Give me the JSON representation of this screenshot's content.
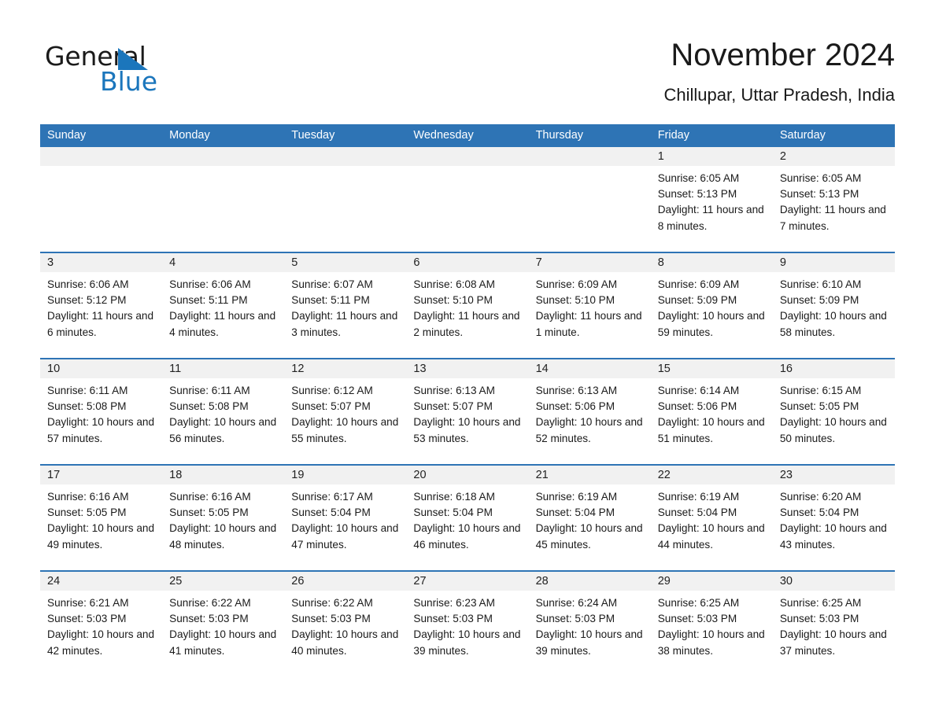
{
  "brand": {
    "name_part1": "General",
    "name_part2": "Blue",
    "accent_color": "#1b76bc"
  },
  "header": {
    "title": "November 2024",
    "subtitle": "Chillupar, Uttar Pradesh, India"
  },
  "theme": {
    "header_blue": "#2e74b5",
    "band_gray": "#f1f1f1",
    "text": "#1a1a1a"
  },
  "weekdays": [
    "Sunday",
    "Monday",
    "Tuesday",
    "Wednesday",
    "Thursday",
    "Friday",
    "Saturday"
  ],
  "weeks": [
    [
      {
        "day": "",
        "sunrise": "",
        "sunset": "",
        "daylight": ""
      },
      {
        "day": "",
        "sunrise": "",
        "sunset": "",
        "daylight": ""
      },
      {
        "day": "",
        "sunrise": "",
        "sunset": "",
        "daylight": ""
      },
      {
        "day": "",
        "sunrise": "",
        "sunset": "",
        "daylight": ""
      },
      {
        "day": "",
        "sunrise": "",
        "sunset": "",
        "daylight": ""
      },
      {
        "day": "1",
        "sunrise": "Sunrise: 6:05 AM",
        "sunset": "Sunset: 5:13 PM",
        "daylight": "Daylight: 11 hours and 8 minutes."
      },
      {
        "day": "2",
        "sunrise": "Sunrise: 6:05 AM",
        "sunset": "Sunset: 5:13 PM",
        "daylight": "Daylight: 11 hours and 7 minutes."
      }
    ],
    [
      {
        "day": "3",
        "sunrise": "Sunrise: 6:06 AM",
        "sunset": "Sunset: 5:12 PM",
        "daylight": "Daylight: 11 hours and 6 minutes."
      },
      {
        "day": "4",
        "sunrise": "Sunrise: 6:06 AM",
        "sunset": "Sunset: 5:11 PM",
        "daylight": "Daylight: 11 hours and 4 minutes."
      },
      {
        "day": "5",
        "sunrise": "Sunrise: 6:07 AM",
        "sunset": "Sunset: 5:11 PM",
        "daylight": "Daylight: 11 hours and 3 minutes."
      },
      {
        "day": "6",
        "sunrise": "Sunrise: 6:08 AM",
        "sunset": "Sunset: 5:10 PM",
        "daylight": "Daylight: 11 hours and 2 minutes."
      },
      {
        "day": "7",
        "sunrise": "Sunrise: 6:09 AM",
        "sunset": "Sunset: 5:10 PM",
        "daylight": "Daylight: 11 hours and 1 minute."
      },
      {
        "day": "8",
        "sunrise": "Sunrise: 6:09 AM",
        "sunset": "Sunset: 5:09 PM",
        "daylight": "Daylight: 10 hours and 59 minutes."
      },
      {
        "day": "9",
        "sunrise": "Sunrise: 6:10 AM",
        "sunset": "Sunset: 5:09 PM",
        "daylight": "Daylight: 10 hours and 58 minutes."
      }
    ],
    [
      {
        "day": "10",
        "sunrise": "Sunrise: 6:11 AM",
        "sunset": "Sunset: 5:08 PM",
        "daylight": "Daylight: 10 hours and 57 minutes."
      },
      {
        "day": "11",
        "sunrise": "Sunrise: 6:11 AM",
        "sunset": "Sunset: 5:08 PM",
        "daylight": "Daylight: 10 hours and 56 minutes."
      },
      {
        "day": "12",
        "sunrise": "Sunrise: 6:12 AM",
        "sunset": "Sunset: 5:07 PM",
        "daylight": "Daylight: 10 hours and 55 minutes."
      },
      {
        "day": "13",
        "sunrise": "Sunrise: 6:13 AM",
        "sunset": "Sunset: 5:07 PM",
        "daylight": "Daylight: 10 hours and 53 minutes."
      },
      {
        "day": "14",
        "sunrise": "Sunrise: 6:13 AM",
        "sunset": "Sunset: 5:06 PM",
        "daylight": "Daylight: 10 hours and 52 minutes."
      },
      {
        "day": "15",
        "sunrise": "Sunrise: 6:14 AM",
        "sunset": "Sunset: 5:06 PM",
        "daylight": "Daylight: 10 hours and 51 minutes."
      },
      {
        "day": "16",
        "sunrise": "Sunrise: 6:15 AM",
        "sunset": "Sunset: 5:05 PM",
        "daylight": "Daylight: 10 hours and 50 minutes."
      }
    ],
    [
      {
        "day": "17",
        "sunrise": "Sunrise: 6:16 AM",
        "sunset": "Sunset: 5:05 PM",
        "daylight": "Daylight: 10 hours and 49 minutes."
      },
      {
        "day": "18",
        "sunrise": "Sunrise: 6:16 AM",
        "sunset": "Sunset: 5:05 PM",
        "daylight": "Daylight: 10 hours and 48 minutes."
      },
      {
        "day": "19",
        "sunrise": "Sunrise: 6:17 AM",
        "sunset": "Sunset: 5:04 PM",
        "daylight": "Daylight: 10 hours and 47 minutes."
      },
      {
        "day": "20",
        "sunrise": "Sunrise: 6:18 AM",
        "sunset": "Sunset: 5:04 PM",
        "daylight": "Daylight: 10 hours and 46 minutes."
      },
      {
        "day": "21",
        "sunrise": "Sunrise: 6:19 AM",
        "sunset": "Sunset: 5:04 PM",
        "daylight": "Daylight: 10 hours and 45 minutes."
      },
      {
        "day": "22",
        "sunrise": "Sunrise: 6:19 AM",
        "sunset": "Sunset: 5:04 PM",
        "daylight": "Daylight: 10 hours and 44 minutes."
      },
      {
        "day": "23",
        "sunrise": "Sunrise: 6:20 AM",
        "sunset": "Sunset: 5:04 PM",
        "daylight": "Daylight: 10 hours and 43 minutes."
      }
    ],
    [
      {
        "day": "24",
        "sunrise": "Sunrise: 6:21 AM",
        "sunset": "Sunset: 5:03 PM",
        "daylight": "Daylight: 10 hours and 42 minutes."
      },
      {
        "day": "25",
        "sunrise": "Sunrise: 6:22 AM",
        "sunset": "Sunset: 5:03 PM",
        "daylight": "Daylight: 10 hours and 41 minutes."
      },
      {
        "day": "26",
        "sunrise": "Sunrise: 6:22 AM",
        "sunset": "Sunset: 5:03 PM",
        "daylight": "Daylight: 10 hours and 40 minutes."
      },
      {
        "day": "27",
        "sunrise": "Sunrise: 6:23 AM",
        "sunset": "Sunset: 5:03 PM",
        "daylight": "Daylight: 10 hours and 39 minutes."
      },
      {
        "day": "28",
        "sunrise": "Sunrise: 6:24 AM",
        "sunset": "Sunset: 5:03 PM",
        "daylight": "Daylight: 10 hours and 39 minutes."
      },
      {
        "day": "29",
        "sunrise": "Sunrise: 6:25 AM",
        "sunset": "Sunset: 5:03 PM",
        "daylight": "Daylight: 10 hours and 38 minutes."
      },
      {
        "day": "30",
        "sunrise": "Sunrise: 6:25 AM",
        "sunset": "Sunset: 5:03 PM",
        "daylight": "Daylight: 10 hours and 37 minutes."
      }
    ]
  ]
}
